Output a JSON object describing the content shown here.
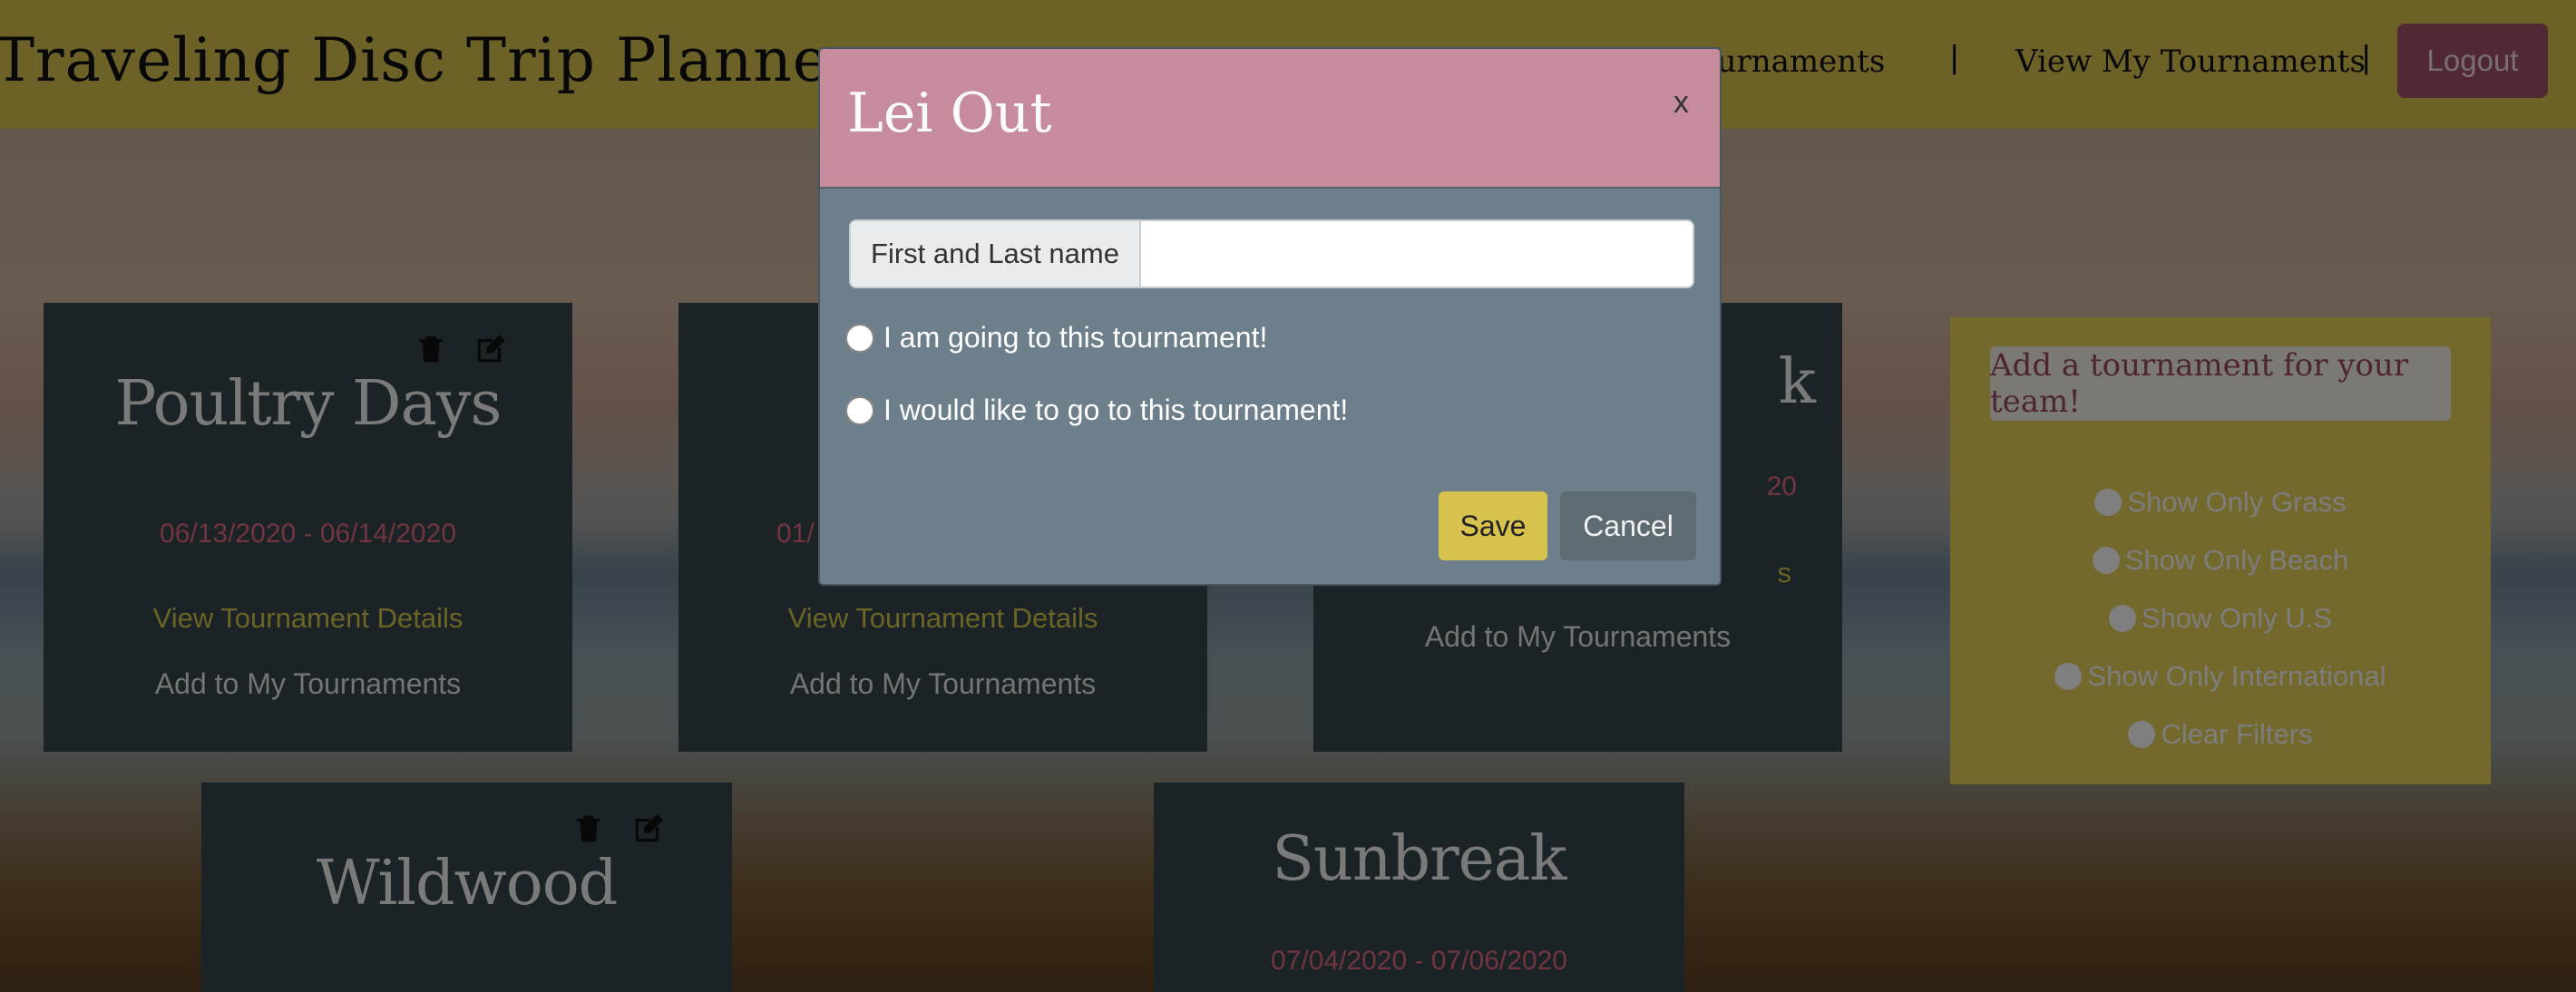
{
  "navbar": {
    "brand": "Traveling Disc Trip Planner",
    "links": [
      {
        "label": "All Tournaments"
      },
      {
        "label": "View My Tournaments"
      }
    ],
    "separator": "|",
    "logout_label": "Logout"
  },
  "cards": [
    {
      "title": "Poultry Days",
      "dates": "06/13/2020 - 06/14/2020",
      "details": "View Tournament Details",
      "add": "Add to My Tournaments"
    },
    {
      "title": "",
      "dates": "01/",
      "details": "View Tournament Details",
      "add": "Add to My Tournaments"
    },
    {
      "title": "k",
      "dates": "20",
      "details": "s",
      "add": "Add to My Tournaments"
    },
    {
      "title": "Wildwood"
    },
    {
      "title": "Sunbreak",
      "dates": "07/04/2020 - 07/06/2020"
    }
  ],
  "sidebar": {
    "add_button": "Add a tournament for your team!",
    "filters": [
      "Show Only Grass",
      "Show Only Beach",
      "Show Only U.S",
      "Show Only International",
      "Clear Filters"
    ]
  },
  "modal": {
    "title": "Lei Out",
    "close": "x",
    "name_label": "First and Last name",
    "name_value": "",
    "radio_going": "I am going to this tournament!",
    "radio_would_like": "I would like to go to this tournament!",
    "save_label": "Save",
    "cancel_label": "Cancel"
  },
  "colors": {
    "navbar": "#d8c24e",
    "modal_header": "#c68c9c",
    "modal_body": "#6c7f8b",
    "save": "#d8c24e",
    "logout": "#a0536a"
  }
}
